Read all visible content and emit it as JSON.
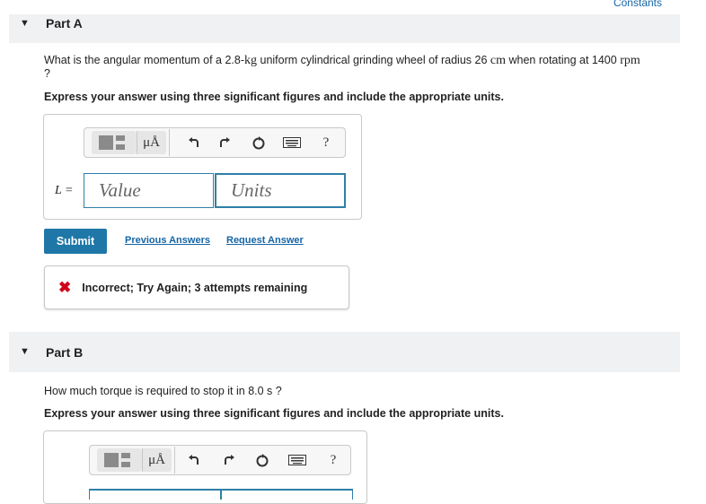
{
  "header": {
    "constants_link": "Constants"
  },
  "part_a": {
    "title": "Part A",
    "question_pre": "What is the angular momentum of a 2.8-",
    "question_unit1": "kg",
    "question_mid": " uniform cylindrical grinding wheel of radius 26 ",
    "question_unit2": "cm",
    "question_mid2": " when rotating at 1400 ",
    "question_unit3": "rpm",
    "question_end": "?",
    "instructions": "Express your answer using three significant figures and include the appropriate units.",
    "toolbar": {
      "mu_label": "μÅ",
      "help_label": "?"
    },
    "variable_label": "L =",
    "value_placeholder": "Value",
    "units_placeholder": "Units",
    "submit_label": "Submit",
    "previous_answers_label": "Previous Answers",
    "request_answer_label": "Request Answer",
    "feedback_text": "Incorrect; Try Again; 3 attempts remaining"
  },
  "part_b": {
    "title": "Part B",
    "question": "How much torque is required to stop it in 8.0 s ?",
    "instructions": "Express your answer using three significant figures and include the appropriate units.",
    "toolbar": {
      "mu_label": "μÅ",
      "help_label": "?"
    }
  },
  "colors": {
    "accent": "#1f77a8",
    "link": "#1565a5",
    "error": "#d0021b",
    "part_bar": "#f0f1f2"
  }
}
